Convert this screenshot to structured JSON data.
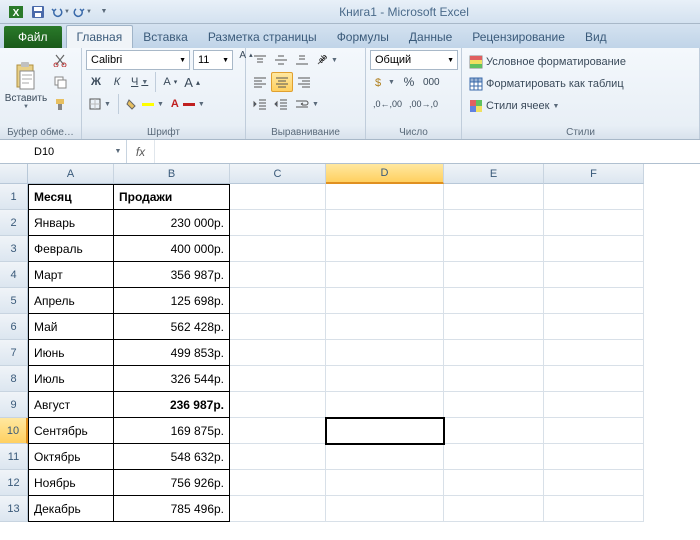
{
  "app": {
    "title": "Книга1 - Microsoft Excel"
  },
  "qat": {
    "excel_icon": "X",
    "save": "save-icon",
    "undo": "undo-icon",
    "redo": "redo-icon"
  },
  "tabs": {
    "file": "Файл",
    "items": [
      "Главная",
      "Вставка",
      "Разметка страницы",
      "Формулы",
      "Данные",
      "Рецензирование",
      "Вид"
    ],
    "active": 0
  },
  "ribbon": {
    "clipboard": {
      "paste": "Вставить",
      "label": "Буфер обме…"
    },
    "font": {
      "name": "Calibri",
      "size": "11",
      "label": "Шрифт",
      "b": "Ж",
      "i": "К",
      "u": "Ч"
    },
    "alignment": {
      "label": "Выравнивание"
    },
    "number": {
      "format": "Общий",
      "label": "Число"
    },
    "styles": {
      "cond": "Условное форматирование",
      "table": "Форматировать как таблиц",
      "cell": "Стили ячеек",
      "label": "Стили"
    }
  },
  "formula": {
    "name_box": "D10",
    "fx": "fx",
    "value": ""
  },
  "columns": [
    "A",
    "B",
    "C",
    "D",
    "E",
    "F"
  ],
  "selected_col": "D",
  "selected_row": 10,
  "sheet": {
    "headers": {
      "a": "Месяц",
      "b": "Продажи"
    },
    "rows": [
      {
        "month": "Январь",
        "sales": "230 000р."
      },
      {
        "month": "Февраль",
        "sales": "400 000р."
      },
      {
        "month": "Март",
        "sales": "356 987р."
      },
      {
        "month": "Апрель",
        "sales": "125 698р."
      },
      {
        "month": "Май",
        "sales": "562 428р."
      },
      {
        "month": "Июнь",
        "sales": "499 853р."
      },
      {
        "month": "Июль",
        "sales": "326 544р."
      },
      {
        "month": "Август",
        "sales": "236 987р.",
        "bold": true
      },
      {
        "month": "Сентябрь",
        "sales": "169 875р."
      },
      {
        "month": "Октябрь",
        "sales": "548 632р."
      },
      {
        "month": "Ноябрь",
        "sales": "756 926р."
      },
      {
        "month": "Декабрь",
        "sales": "785 496р."
      }
    ]
  }
}
